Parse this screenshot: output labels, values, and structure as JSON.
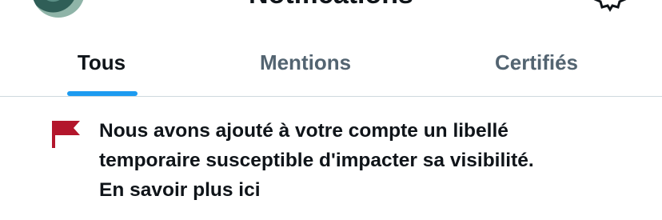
{
  "header": {
    "title": "Notifications"
  },
  "tabs": [
    {
      "label": "Tous",
      "selected": true
    },
    {
      "label": "Mentions",
      "selected": false
    },
    {
      "label": "Certifiés",
      "selected": false
    }
  ],
  "notice": {
    "icon": "flag-icon",
    "lines": [
      "Nous avons ajouté à votre compte un libellé",
      "temporaire susceptible d'impacter sa visibilité.",
      "En savoir plus ici"
    ]
  },
  "colors": {
    "accent": "#1d9bf0",
    "flag": "#b3162c",
    "inactive_tab": "#536471",
    "divider": "#cfd9de"
  }
}
